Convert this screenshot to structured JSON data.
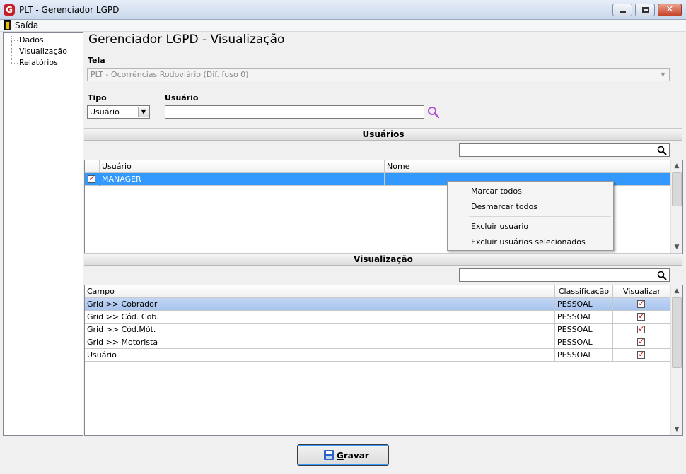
{
  "window": {
    "title": "PLT - Gerenciador LGPD",
    "logo_letter": "G"
  },
  "menu": {
    "exit_label": "Saída"
  },
  "tree": {
    "items": [
      {
        "label": "Dados"
      },
      {
        "label": "Visualização"
      },
      {
        "label": "Relatórios"
      }
    ]
  },
  "page": {
    "title": "Gerenciador LGPD - Visualização"
  },
  "form": {
    "tela_label": "Tela",
    "tela_value": "PLT - Ocorrências Rodoviário (Dif. fuso 0)",
    "tipo_label": "Tipo",
    "tipo_value": "Usuário",
    "usuario_label": "Usuário",
    "usuario_value": ""
  },
  "users_section": {
    "header": "Usuários",
    "filter_value": "",
    "columns": [
      "Usuário",
      "Nome"
    ],
    "rows": [
      {
        "checked": true,
        "usuario": "MANAGER",
        "nome": ""
      }
    ]
  },
  "context_menu": {
    "items": [
      "Marcar todos",
      "Desmarcar todos",
      "Excluir usuário",
      "Excluir usuários selecionados"
    ]
  },
  "view_section": {
    "header": "Visualização",
    "filter_value": "",
    "columns": [
      "Campo",
      "Classificação",
      "Visualizar"
    ],
    "rows": [
      {
        "campo": "Grid >> Cobrador",
        "classificacao": "PESSOAL",
        "visualizar": true
      },
      {
        "campo": "Grid >> Cód. Cob.",
        "classificacao": "PESSOAL",
        "visualizar": true
      },
      {
        "campo": "Grid >> Cód.Mót.",
        "classificacao": "PESSOAL",
        "visualizar": true
      },
      {
        "campo": "Grid >> Motorista",
        "classificacao": "PESSOAL",
        "visualizar": true
      },
      {
        "campo": "Usuário",
        "classificacao": "PESSOAL",
        "visualizar": true
      }
    ]
  },
  "footer": {
    "save_label": "Gravar",
    "save_underline": "G",
    "save_rest": "ravar"
  },
  "colors": {
    "selection": "#3399ff",
    "highlight": "#b7cff2",
    "check": "#dd0000",
    "search_icon": "#b04fd0"
  }
}
